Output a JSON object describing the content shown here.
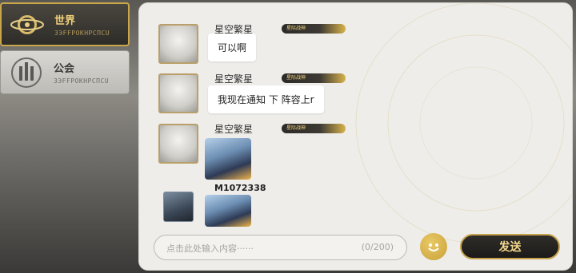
{
  "tabs": [
    {
      "label": "世界",
      "sub": "ЗЭFFPОКНРСПСU"
    },
    {
      "label": "公会",
      "sub": "ЗЭFFPОКНРСПСU"
    }
  ],
  "messages": [
    {
      "name": "星空繁星",
      "badge": "星际战神",
      "text": "可以啊"
    },
    {
      "name": "星空繁星",
      "badge": "星际战神",
      "text": "我现在通知 下 阵容上r"
    },
    {
      "name": "星空繁星",
      "badge": "星际战神",
      "sticker_caption": "M1072338"
    }
  ],
  "input": {
    "placeholder": "点击此处输入内容······",
    "count": "(0/200)"
  },
  "send_label": "发送",
  "colors": {
    "gold": "#c9a64a",
    "panel": "#eeedea",
    "send_bg": "#1c1b19"
  }
}
